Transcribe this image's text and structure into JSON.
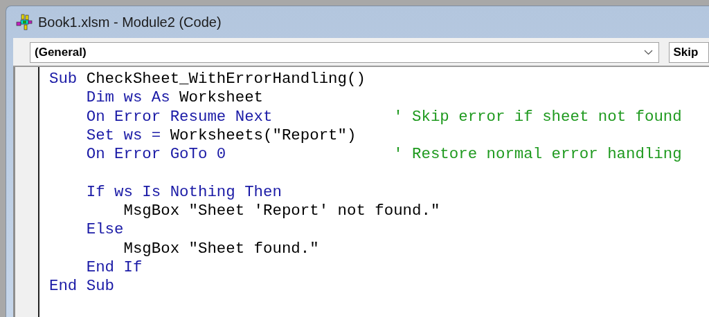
{
  "window": {
    "title": "Book1.xlsm - Module2 (Code)"
  },
  "object_dropdown": {
    "value": "(General)"
  },
  "procedure_dropdown": {
    "value": "Skip"
  },
  "code_lines": [
    [
      {
        "kind": "keyword",
        "text": "Sub"
      },
      {
        "kind": "plain",
        "text": " CheckSheet_WithErrorHandling()"
      }
    ],
    [
      {
        "kind": "keyword",
        "text": "    Dim ws As"
      },
      {
        "kind": "plain",
        "text": " Worksheet"
      }
    ],
    [
      {
        "kind": "keyword",
        "text": "    On Error Resume Next"
      },
      {
        "kind": "comment",
        "text": "' Skip error if sheet not found"
      }
    ],
    [
      {
        "kind": "keyword",
        "text": "    Set ws ="
      },
      {
        "kind": "plain",
        "text": " Worksheets(\"Report\")"
      }
    ],
    [
      {
        "kind": "keyword",
        "text": "    On Error GoTo 0"
      },
      {
        "kind": "comment",
        "text": "' Restore normal error handling"
      }
    ],
    [
      {
        "kind": "blank_line_before"
      },
      {
        "kind": "keyword",
        "text": "    If ws Is Nothing Then"
      }
    ],
    [
      {
        "kind": "plain",
        "text": "        MsgBox \"Sheet 'Report' not found.\""
      }
    ],
    [
      {
        "kind": "keyword",
        "text": "    Else"
      }
    ],
    [
      {
        "kind": "plain",
        "text": "        MsgBox \"Sheet found.\""
      }
    ],
    [
      {
        "kind": "keyword",
        "text": "    End If"
      }
    ],
    [
      {
        "kind": "keyword",
        "text": "End Sub"
      }
    ]
  ]
}
